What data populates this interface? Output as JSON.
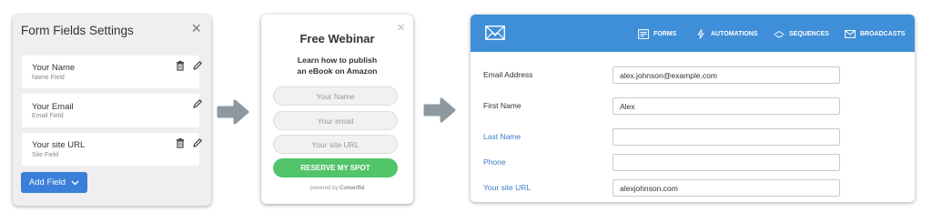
{
  "settings_panel": {
    "title": "Form Fields Settings",
    "close_glyph": "×",
    "fields": [
      {
        "name": "Your Name",
        "type": "Name Field",
        "icons": [
          "trash-icon",
          "pencil-icon"
        ]
      },
      {
        "name": "Your Email",
        "type": "Email Field",
        "icons": [
          "pencil-icon"
        ]
      },
      {
        "name": "Your site URL",
        "type": "Site Field",
        "icons": [
          "trash-icon",
          "pencil-icon"
        ]
      }
    ],
    "add_button": "Add Field"
  },
  "popup": {
    "close_glyph": "×",
    "title": "Free Webinar",
    "subtitle_line1": "Learn how to publish",
    "subtitle_line2": "an eBook on Amazon",
    "placeholders": [
      "Your Name",
      "Your email",
      "Your site URL"
    ],
    "cta": "RESERVE MY SPOT",
    "powered_by": "powered by",
    "brand": "Convertful"
  },
  "subscriber_form": {
    "nav": [
      "FORMS",
      "AUTOMATIONS",
      "SEQUENCES",
      "BROADCASTS"
    ],
    "rows": [
      {
        "label": "Email Address",
        "value": "alex.johnson@example.com",
        "highlight": false
      },
      {
        "label": "First Name",
        "value": "Alex",
        "highlight": false
      },
      {
        "label": "Last Name",
        "value": "",
        "highlight": true
      },
      {
        "label": "Phone",
        "value": "",
        "highlight": true
      },
      {
        "label": "Your site URL",
        "value": "alexjohnson.com",
        "highlight": true
      }
    ]
  },
  "colors": {
    "primary_blue": "#3f8ed8",
    "button_blue": "#3a7fd9",
    "cta_green": "#52c46a",
    "label_blue": "#3d7cc9",
    "arrow_gray": "#8e989f"
  }
}
